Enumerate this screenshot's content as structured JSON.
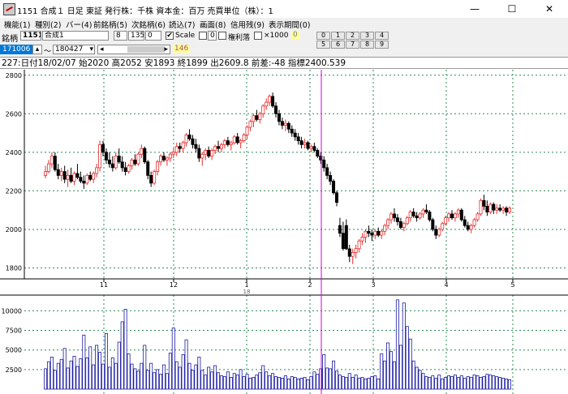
{
  "window": {
    "title": "1151 合成１ 日足 東証 発行株：千株 資本金：百万 売買単位（株）：1",
    "minimize_symbol": "—",
    "maximize_symbol": "☐",
    "close_symbol": "✕"
  },
  "menu": [
    "機能(1)",
    "種別(2)",
    "バー(4)",
    "前銘柄(5)",
    "次銘柄(6)",
    "読込(7)",
    "画面(8)",
    "信用残(9)",
    "表示期間(0)"
  ],
  "toolbar": {
    "code_label": "銘柄",
    "code_value": "1151",
    "name_value": "合成1",
    "field_a": "8",
    "field_b": "1350",
    "field_c": "0",
    "scale_label": "Scale",
    "scale_checked": "✔",
    "scale_value": "0",
    "margin_label": "権利落",
    "x1000_label": "×1000",
    "badge_value": "0",
    "start_date": "171006",
    "tilde": "〜",
    "end_date": "180427",
    "scroll_count": "146",
    "num_buttons": [
      "0",
      "1",
      "2",
      "3",
      "4",
      "5",
      "6",
      "7",
      "8",
      "9"
    ]
  },
  "info_line": "227:日付18/02/07 始2020 高2052 安1893 終1899 出2609.8 前差:-48 指標2400.539",
  "chart_data": {
    "type": "candlestick",
    "y_ticks": [
      1800,
      2000,
      2200,
      2400,
      2600,
      2800
    ],
    "y_range": [
      1760,
      2820
    ],
    "x_month_labels": [
      "11",
      "12",
      "1",
      "2",
      "3",
      "4",
      "5"
    ],
    "year_label": "18",
    "volume_ticks": [
      2500,
      5000,
      7500,
      10000
    ],
    "volume_range": [
      0,
      11800
    ],
    "up_color": "#e53030",
    "down_color": "#000000",
    "cursor_color": "#d000d0",
    "grid_color": "#2e8b57",
    "volume_color": "#1a1aa0",
    "candles_ohlc": [
      [
        2280,
        2330,
        2265,
        2300
      ],
      [
        2300,
        2360,
        2290,
        2340
      ],
      [
        2340,
        2400,
        2320,
        2380
      ],
      [
        2380,
        2400,
        2300,
        2310
      ],
      [
        2310,
        2340,
        2260,
        2280
      ],
      [
        2280,
        2320,
        2250,
        2300
      ],
      [
        2300,
        2330,
        2240,
        2260
      ],
      [
        2260,
        2310,
        2220,
        2280
      ],
      [
        2280,
        2320,
        2240,
        2250
      ],
      [
        2250,
        2300,
        2230,
        2290
      ],
      [
        2290,
        2340,
        2260,
        2270
      ],
      [
        2270,
        2300,
        2240,
        2250
      ],
      [
        2250,
        2280,
        2210,
        2240
      ],
      [
        2240,
        2290,
        2230,
        2280
      ],
      [
        2280,
        2300,
        2250,
        2260
      ],
      [
        2260,
        2300,
        2240,
        2290
      ],
      [
        2290,
        2340,
        2270,
        2320
      ],
      [
        2320,
        2460,
        2300,
        2440
      ],
      [
        2440,
        2460,
        2380,
        2400
      ],
      [
        2400,
        2420,
        2340,
        2360
      ],
      [
        2360,
        2400,
        2320,
        2340
      ],
      [
        2340,
        2380,
        2300,
        2320
      ],
      [
        2320,
        2400,
        2310,
        2380
      ],
      [
        2380,
        2420,
        2340,
        2350
      ],
      [
        2350,
        2380,
        2300,
        2320
      ],
      [
        2320,
        2350,
        2280,
        2300
      ],
      [
        2300,
        2340,
        2290,
        2330
      ],
      [
        2330,
        2370,
        2310,
        2360
      ],
      [
        2360,
        2390,
        2330,
        2340
      ],
      [
        2340,
        2400,
        2330,
        2390
      ],
      [
        2390,
        2440,
        2370,
        2420
      ],
      [
        2420,
        2430,
        2340,
        2350
      ],
      [
        2350,
        2360,
        2260,
        2280
      ],
      [
        2280,
        2300,
        2220,
        2240
      ],
      [
        2240,
        2310,
        2230,
        2300
      ],
      [
        2300,
        2360,
        2280,
        2350
      ],
      [
        2350,
        2390,
        2330,
        2380
      ],
      [
        2380,
        2400,
        2350,
        2360
      ],
      [
        2360,
        2380,
        2330,
        2370
      ],
      [
        2370,
        2400,
        2350,
        2390
      ],
      [
        2390,
        2420,
        2370,
        2400
      ],
      [
        2400,
        2450,
        2380,
        2430
      ],
      [
        2430,
        2450,
        2400,
        2420
      ],
      [
        2420,
        2460,
        2400,
        2450
      ],
      [
        2450,
        2500,
        2430,
        2490
      ],
      [
        2490,
        2520,
        2460,
        2470
      ],
      [
        2470,
        2490,
        2420,
        2440
      ],
      [
        2440,
        2470,
        2400,
        2420
      ],
      [
        2420,
        2440,
        2350,
        2370
      ],
      [
        2370,
        2400,
        2330,
        2390
      ],
      [
        2390,
        2420,
        2360,
        2410
      ],
      [
        2410,
        2430,
        2370,
        2380
      ],
      [
        2380,
        2420,
        2360,
        2410
      ],
      [
        2410,
        2440,
        2390,
        2430
      ],
      [
        2430,
        2460,
        2400,
        2420
      ],
      [
        2420,
        2450,
        2400,
        2440
      ],
      [
        2440,
        2470,
        2420,
        2460
      ],
      [
        2460,
        2480,
        2430,
        2440
      ],
      [
        2440,
        2460,
        2410,
        2450
      ],
      [
        2450,
        2490,
        2440,
        2480
      ],
      [
        2480,
        2500,
        2440,
        2450
      ],
      [
        2450,
        2470,
        2420,
        2460
      ],
      [
        2460,
        2500,
        2450,
        2490
      ],
      [
        2490,
        2540,
        2470,
        2530
      ],
      [
        2530,
        2570,
        2510,
        2560
      ],
      [
        2560,
        2600,
        2530,
        2590
      ],
      [
        2590,
        2620,
        2560,
        2570
      ],
      [
        2570,
        2610,
        2550,
        2600
      ],
      [
        2600,
        2650,
        2580,
        2640
      ],
      [
        2640,
        2680,
        2620,
        2660
      ],
      [
        2660,
        2700,
        2640,
        2690
      ],
      [
        2690,
        2710,
        2630,
        2640
      ],
      [
        2640,
        2660,
        2580,
        2600
      ],
      [
        2600,
        2620,
        2540,
        2560
      ],
      [
        2560,
        2580,
        2520,
        2540
      ],
      [
        2540,
        2570,
        2510,
        2550
      ],
      [
        2550,
        2560,
        2500,
        2520
      ],
      [
        2520,
        2540,
        2480,
        2500
      ],
      [
        2500,
        2520,
        2460,
        2480
      ],
      [
        2480,
        2500,
        2440,
        2460
      ],
      [
        2460,
        2480,
        2420,
        2440
      ],
      [
        2440,
        2470,
        2420,
        2450
      ],
      [
        2450,
        2460,
        2410,
        2420
      ],
      [
        2420,
        2440,
        2400,
        2430
      ],
      [
        2430,
        2450,
        2400,
        2410
      ],
      [
        2410,
        2420,
        2370,
        2380
      ],
      [
        2380,
        2400,
        2340,
        2360
      ],
      [
        2360,
        2380,
        2300,
        2320
      ],
      [
        2320,
        2340,
        2260,
        2280
      ],
      [
        2280,
        2300,
        2230,
        2250
      ],
      [
        2250,
        2260,
        2180,
        2190
      ],
      [
        2190,
        2200,
        2120,
        2140
      ],
      [
        2020,
        2060,
        1960,
        1980
      ],
      [
        1980,
        2040,
        1890,
        1900
      ],
      [
        2020,
        2052,
        1893,
        1899
      ],
      [
        1899,
        1920,
        1830,
        1860
      ],
      [
        1860,
        1900,
        1820,
        1880
      ],
      [
        1880,
        1920,
        1850,
        1900
      ],
      [
        1900,
        1950,
        1880,
        1940
      ],
      [
        1940,
        1980,
        1920,
        1960
      ],
      [
        1960,
        2000,
        1930,
        1990
      ],
      [
        1990,
        2020,
        1960,
        1980
      ],
      [
        1980,
        2000,
        1940,
        1970
      ],
      [
        1970,
        2000,
        1950,
        1990
      ],
      [
        1990,
        2010,
        1960,
        1970
      ],
      [
        1970,
        2000,
        1950,
        1990
      ],
      [
        1990,
        2030,
        1970,
        2020
      ],
      [
        2020,
        2060,
        2000,
        2050
      ],
      [
        2050,
        2090,
        2030,
        2080
      ],
      [
        2080,
        2110,
        2040,
        2060
      ],
      [
        2060,
        2080,
        2020,
        2040
      ],
      [
        2040,
        2060,
        2000,
        2010
      ],
      [
        2010,
        2040,
        1990,
        2030
      ],
      [
        2030,
        2070,
        2020,
        2060
      ],
      [
        2060,
        2100,
        2040,
        2090
      ],
      [
        2090,
        2110,
        2060,
        2070
      ],
      [
        2070,
        2090,
        2040,
        2060
      ],
      [
        2060,
        2090,
        2050,
        2080
      ],
      [
        2080,
        2110,
        2060,
        2100
      ],
      [
        2100,
        2130,
        2080,
        2090
      ],
      [
        2090,
        2100,
        2040,
        2050
      ],
      [
        2050,
        2060,
        1990,
        2000
      ],
      [
        2000,
        2020,
        1950,
        1970
      ],
      [
        1970,
        2010,
        1960,
        2000
      ],
      [
        2000,
        2040,
        1990,
        2030
      ],
      [
        2030,
        2070,
        2020,
        2060
      ],
      [
        2060,
        2090,
        2040,
        2080
      ],
      [
        2080,
        2100,
        2050,
        2060
      ],
      [
        2060,
        2090,
        2040,
        2080
      ],
      [
        2080,
        2110,
        2060,
        2100
      ],
      [
        2100,
        2110,
        2040,
        2050
      ],
      [
        2050,
        2070,
        2010,
        2020
      ],
      [
        2020,
        2040,
        1990,
        2000
      ],
      [
        2000,
        2030,
        1980,
        2020
      ],
      [
        2020,
        2060,
        2010,
        2050
      ],
      [
        2050,
        2090,
        2040,
        2080
      ],
      [
        2080,
        2160,
        2070,
        2150
      ],
      [
        2150,
        2180,
        2100,
        2120
      ],
      [
        2120,
        2150,
        2070,
        2090
      ],
      [
        2090,
        2140,
        2080,
        2130
      ],
      [
        2130,
        2140,
        2080,
        2100
      ],
      [
        2100,
        2130,
        2080,
        2110
      ],
      [
        2110,
        2130,
        2090,
        2100
      ],
      [
        2100,
        2120,
        2080,
        2110
      ],
      [
        2110,
        2120,
        2070,
        2090
      ],
      [
        2090,
        2120,
        2080,
        2110
      ]
    ],
    "volume": [
      2600,
      3500,
      4100,
      2400,
      3300,
      3800,
      5200,
      2700,
      3600,
      4200,
      2900,
      3900,
      6900,
      4000,
      5400,
      3100,
      5600,
      4700,
      3200,
      7100,
      2800,
      4000,
      3300,
      6000,
      8600,
      10200,
      4500,
      3200,
      2600,
      2300,
      3300,
      5600,
      2400,
      3300,
      2100,
      2500,
      1900,
      3100,
      2000,
      4600,
      7800,
      3500,
      2800,
      4400,
      6300,
      3300,
      2400,
      3100,
      4100,
      2400,
      1800,
      2800,
      2200,
      3000,
      2100,
      1700,
      1600,
      2200,
      1500,
      2000,
      1800,
      2500,
      1600,
      1900,
      1400,
      1500,
      1800,
      2100,
      3000,
      2200,
      1700,
      2000,
      1600,
      1500,
      1400,
      1700,
      1300,
      1600,
      1500,
      1300,
      1400,
      1500,
      1200,
      1600,
      2200,
      1900,
      2600,
      4400,
      2700,
      2600,
      3600,
      2300,
      1800,
      1600,
      1500,
      2000,
      1500,
      1800,
      1400,
      1500,
      1300,
      1400,
      1600,
      1700,
      1300,
      4500,
      3600,
      5900,
      4800,
      3500,
      11400,
      5600,
      11000,
      8000,
      6400,
      3600,
      2800,
      2400,
      2000,
      1600,
      1500,
      1700,
      1400,
      1800,
      1300,
      1500,
      1700,
      1600,
      1800,
      1500,
      1700,
      1400,
      1600,
      1500,
      1800,
      1700,
      1500,
      1600,
      1900,
      1800,
      1700,
      1600,
      1500,
      1400,
      1300,
      1200
    ]
  }
}
